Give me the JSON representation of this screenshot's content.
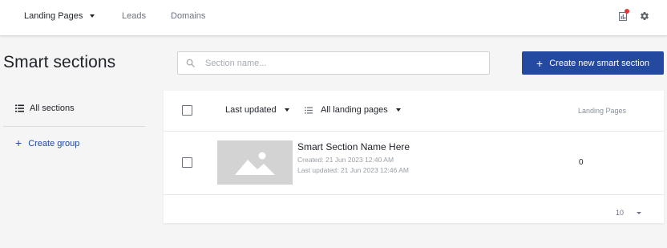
{
  "topbar": {
    "nav": [
      {
        "label": "Landing Pages",
        "active": true
      },
      {
        "label": "Leads"
      },
      {
        "label": "Domains"
      }
    ],
    "icons": {
      "report": "report-icon",
      "settings": "gear-icon"
    },
    "notification_color": "#e53935"
  },
  "page": {
    "title": "Smart sections"
  },
  "search": {
    "placeholder": "Section name..."
  },
  "actions": {
    "create_label": "Create new smart section",
    "accent_color": "#2449a0"
  },
  "sidebar": {
    "all_sections_label": "All sections",
    "create_group_label": "Create group"
  },
  "table": {
    "sort_label": "Last updated",
    "filter_label": "All landing pages",
    "column_landing_pages": "Landing Pages",
    "rows": [
      {
        "name": "Smart Section Name Here",
        "created": "Created: 21 Jun 2023 12:40 AM",
        "updated": "Last updated: 21 Jun 2023 12:46 AM",
        "landing_pages": "0"
      }
    ],
    "page_size": "10"
  }
}
